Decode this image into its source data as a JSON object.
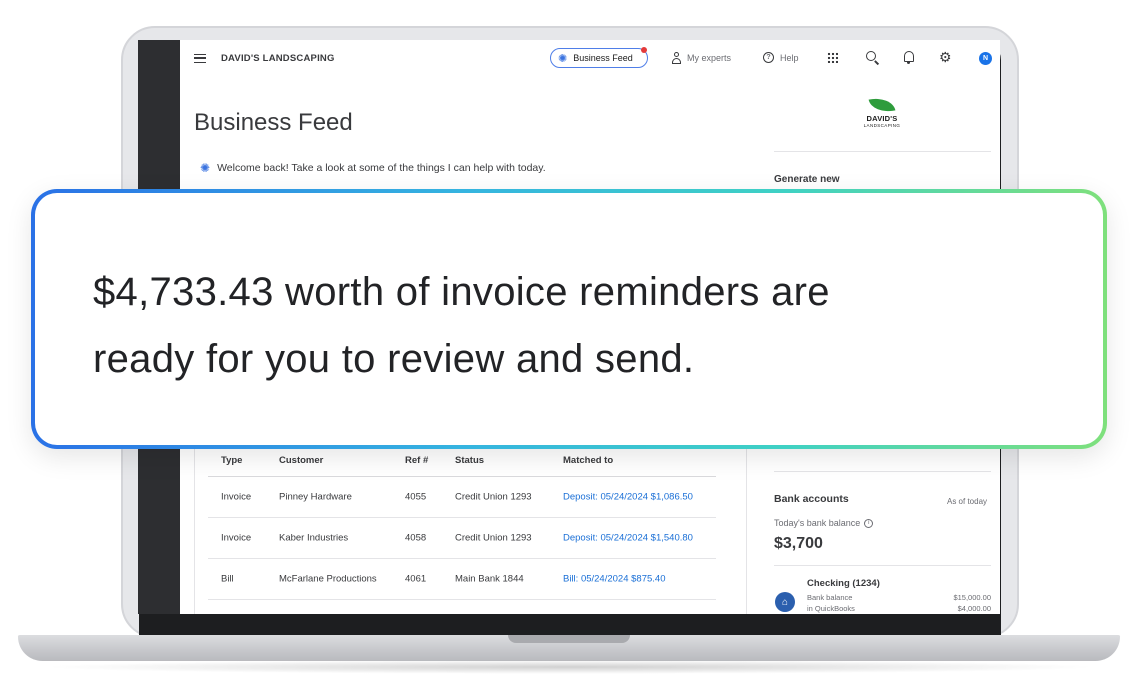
{
  "topbar": {
    "company": "DAVID'S LANDSCAPING",
    "business_feed": "Business Feed",
    "my_experts": "My experts",
    "help": "Help",
    "avatar_initial": "N"
  },
  "page": {
    "title": "Business Feed",
    "welcome": "Welcome back! Take a look at some of the things I can help with today.",
    "generate_new": "Generate new"
  },
  "logo": {
    "name": "DAVID'S",
    "sub": "LANDSCAPING"
  },
  "callout": {
    "line1": "$4,733.43 worth of invoice reminders are",
    "line2": "ready for you to review and send."
  },
  "table": {
    "headers": [
      "Type",
      "Customer",
      "Ref #",
      "Status",
      "Matched to"
    ],
    "rows": [
      [
        "Invoice",
        "Pinney Hardware",
        "4055",
        "Credit Union 1293",
        "Deposit: 05/24/2024 $1,086.50"
      ],
      [
        "Invoice",
        "Kaber Industries",
        "4058",
        "Credit Union 1293",
        "Deposit: 05/24/2024 $1,540.80"
      ],
      [
        "Bill",
        "McFarlane Productions",
        "4061",
        "Main Bank 1844",
        "Bill: 05/24/2024 $875.40"
      ]
    ]
  },
  "bank": {
    "title": "Bank accounts",
    "as_of": "As of today",
    "today_label": "Today's bank balance",
    "today_amount": "$3,700",
    "account_name": "Checking (1234)",
    "label_bank_balance": "Bank balance",
    "label_in_qb": "in QuickBooks",
    "bank_balance": "$15,000.00",
    "qb_balance": "$4,000.00"
  },
  "colors": {
    "accent_blue": "#1a6fd6",
    "brand_green": "#2e9c3c",
    "gradient": [
      "#2a71e6",
      "#35b4e0",
      "#3fd1c4",
      "#7fe07c"
    ]
  },
  "icons": [
    "menu-icon",
    "sparkle-icon",
    "person-icon",
    "help-icon",
    "apps-grid-icon",
    "search-icon",
    "bell-icon",
    "gear-icon",
    "info-icon",
    "bank-icon"
  ]
}
